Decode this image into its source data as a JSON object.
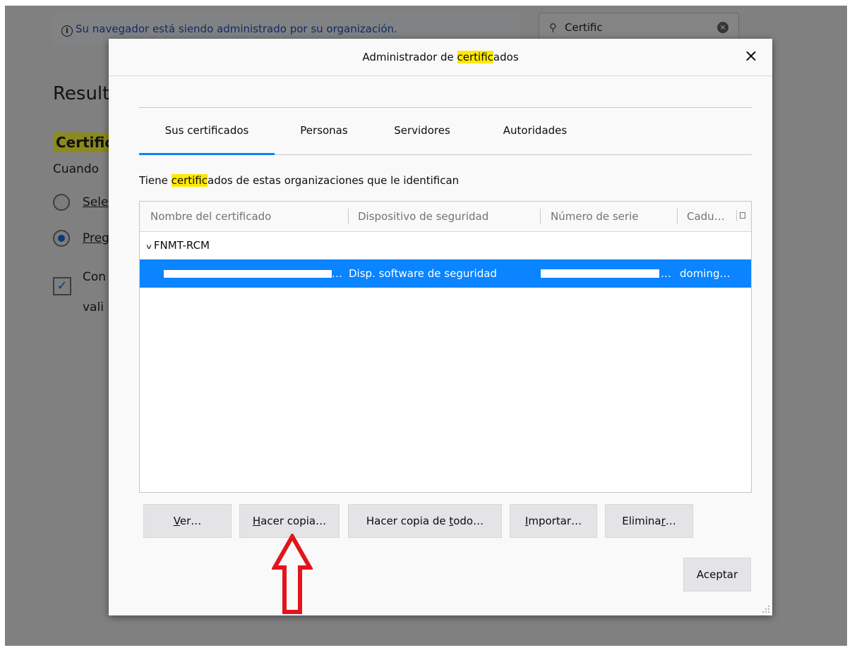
{
  "background": {
    "managed_notice": "Su navegador está siendo administrado por su organización.",
    "search": {
      "value": "Certific",
      "icon": "search-icon",
      "clear_icon": "clear-icon"
    },
    "results_heading": "Result",
    "cert_heading": "Certific",
    "cuando_text": "Cuando",
    "radio_1": "Sele",
    "radio_2": "Preg",
    "checkbox_line1": "Con",
    "checkbox_line2": "vali"
  },
  "dialog": {
    "title_before": "Administrador de ",
    "title_highlight": "certific",
    "title_after": "ados",
    "close_label": "×",
    "tabs": [
      {
        "label": "Sus certificados",
        "active": true
      },
      {
        "label": "Personas",
        "active": false
      },
      {
        "label": "Servidores",
        "active": false
      },
      {
        "label": "Autoridades",
        "active": false
      }
    ],
    "description_before": "Tiene ",
    "description_highlight": "certific",
    "description_after": "ados de estas organizaciones que le identifican",
    "columns": [
      "Nombre del certificado",
      "Dispositivo de seguridad",
      "Número de serie",
      "Cadu…"
    ],
    "group": {
      "name": "FNMT-RCM",
      "expanded": true
    },
    "selected_row": {
      "name_suffix": "…",
      "device": "Disp. software de seguridad",
      "serial_suffix": "…",
      "expires": "doming…"
    },
    "buttons": {
      "ver": {
        "text": "er…",
        "access": "V"
      },
      "backup": {
        "pre": "",
        "access": "H",
        "post": "acer copia…"
      },
      "backup_all": {
        "pre": "Hacer copia de ",
        "access": "t",
        "post": "odo…"
      },
      "import": {
        "pre": "",
        "access": "I",
        "post": "mportar…"
      },
      "delete": {
        "pre": "Elimina",
        "access": "r",
        "post": "…"
      }
    },
    "accept_label": "Aceptar"
  },
  "colors": {
    "accent": "#0a84ff",
    "highlight": "#ffe900",
    "arrow": "#e3141b"
  }
}
